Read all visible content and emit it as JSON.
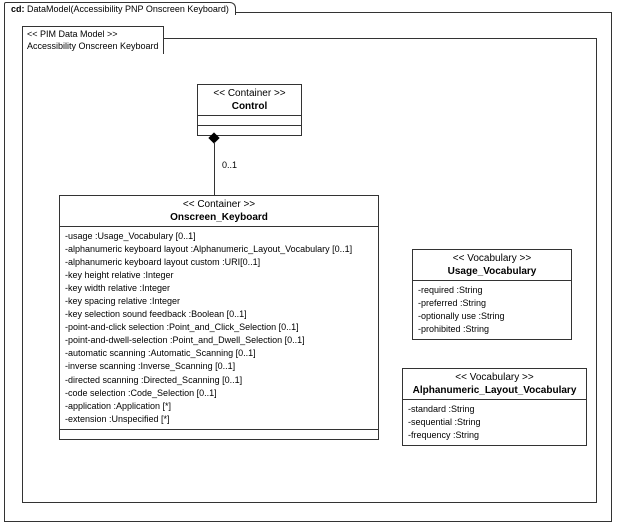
{
  "tab_label": "cd: DataModel(Accessibility PNP Onscreen Keyboard)",
  "package": {
    "stereo": "<< PIM Data Model  >>",
    "name": "Accessibility Onscreen Keyboard"
  },
  "control": {
    "stereo": "<< Container >>",
    "name": "Control"
  },
  "onscreen": {
    "stereo": "<< Container >>",
    "name": "Onscreen_Keyboard",
    "attrs": [
      "-usage :Usage_Vocabulary [0..1]",
      "-alphanumeric keyboard layout   :Alphanumeric_Layout_Vocabulary    [0..1]",
      "-alphanumeric keyboard layout custom    :URI[0..1]",
      "-key height relative   :Integer",
      "-key width relative  :Integer",
      "-key spacing relative   :Integer",
      "-key selection sound feedback  :Boolean [0..1]",
      "-point-and-click selection  :Point_and_Click_Selection  [0..1]",
      "-point-and-dwell-selection :Point_and_Dwell_Selection   [0..1]",
      "-automatic scanning   :Automatic_Scanning  [0..1]",
      "-inverse scanning  :Inverse_Scanning [0..1]",
      "-directed scanning :Directed_Scanning [0..1]",
      "-code selection :Code_Selection [0..1]",
      "-application :Application [*]",
      "-extension :Unspecified [*]"
    ]
  },
  "usage_vocab": {
    "stereo": "<< Vocabulary  >>",
    "name": "Usage_Vocabulary",
    "attrs": [
      "-required :String",
      "-preferred :String",
      "-optionally use :String",
      "-prohibited :String"
    ]
  },
  "alnum_vocab": {
    "stereo": "<< Vocabulary  >>",
    "name": "Alphanumeric_Layout_Vocabulary",
    "attrs": [
      "-standard :String",
      "-sequential :String",
      "-frequency :String"
    ]
  },
  "multiplicity": "0..1"
}
